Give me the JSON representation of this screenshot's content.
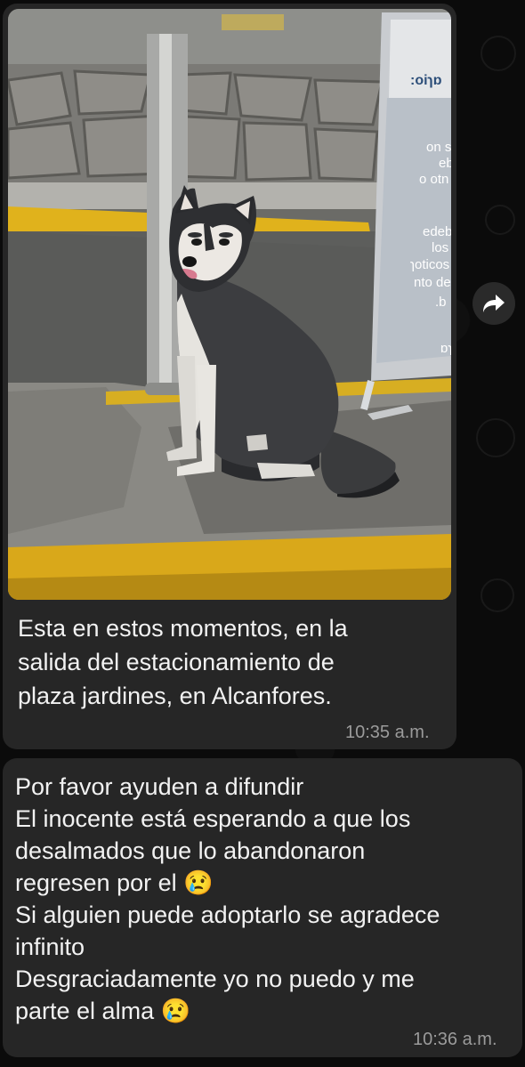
{
  "chat": {
    "messages": [
      {
        "type": "image",
        "caption": "Esta en estos momentos, en la\nsalida del estacionamiento de\nplaza jardines, en Alcanfores.",
        "time": "10:35 a.m."
      },
      {
        "type": "text",
        "text": "Por favor ayuden a difundir\nEl inocente está esperando a que los\ndesalmados que lo abandonaron\nregresen por el 😢\nSi alguien puede adoptarlo se agradece\ninfinito\nDesgraciadamente yo no puedo y me\nparte el alma 😢",
        "time": "10:36 a.m."
      }
    ]
  },
  "photo": {
    "sign_text": ":oiɿɒ\non s\neb\no otn\nedeb\nlos\nɿoticos\nnto de\n.b\nɒɿ"
  },
  "icons": {
    "forward": "forward-arrow-icon"
  },
  "colors": {
    "background": "#0b0b0b",
    "bubble": "#262626",
    "text": "#f2f2f2",
    "timestamp": "#9b9b9b",
    "curb_yellow": "#e0b21c"
  }
}
